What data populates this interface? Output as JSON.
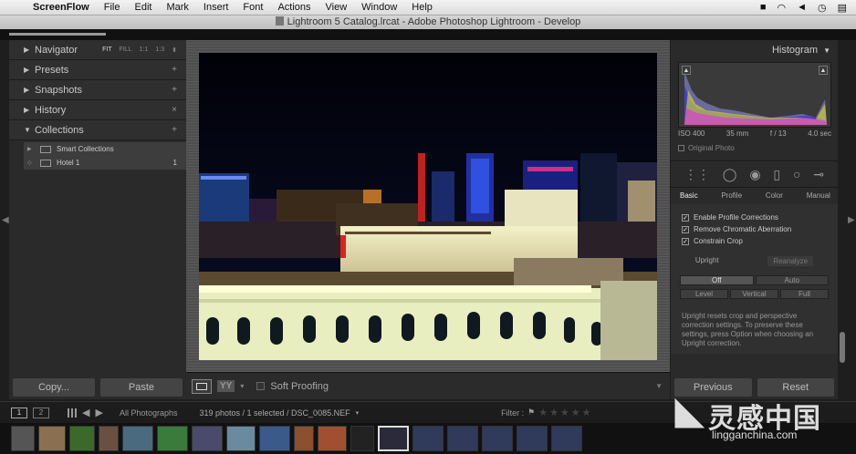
{
  "menubar": {
    "app": "ScreenFlow",
    "items": [
      "File",
      "Edit",
      "Mark",
      "Insert",
      "Font",
      "Actions",
      "View",
      "Window",
      "Help"
    ]
  },
  "window": {
    "title": "Lightroom 5 Catalog.lrcat - Adobe Photoshop Lightroom - Develop"
  },
  "left_panel": {
    "navigator": {
      "label": "Navigator",
      "opts": [
        "FIT",
        "FILL",
        "1:1",
        "1:3"
      ]
    },
    "presets": {
      "label": "Presets",
      "action": "+"
    },
    "snapshots": {
      "label": "Snapshots",
      "action": "+"
    },
    "history": {
      "label": "History",
      "action": "×"
    },
    "collections": {
      "label": "Collections",
      "action": "+",
      "items": [
        {
          "label": "Smart Collections",
          "count": ""
        },
        {
          "label": "Hotel 1",
          "count": "1"
        }
      ]
    },
    "copy_label": "Copy...",
    "paste_label": "Paste"
  },
  "toolbar": {
    "yy": "YY",
    "soft_proofing": "Soft Proofing"
  },
  "right_panel": {
    "histogram_label": "Histogram",
    "exif": {
      "iso": "ISO 400",
      "focal": "35 mm",
      "aperture": "f / 13",
      "shutter": "4.0 sec"
    },
    "original_photo": "Original Photo",
    "lens_tabs": [
      "Basic",
      "Profile",
      "Color",
      "Manual"
    ],
    "checks": [
      "Enable Profile Corrections",
      "Remove Chromatic Aberration",
      "Constrain Crop"
    ],
    "upright_label": "Upright",
    "reanalyze": "Reanalyze",
    "upright_row1": [
      "Off",
      "Auto"
    ],
    "upright_row2": [
      "Level",
      "Vertical",
      "Full"
    ],
    "upright_help": "Upright resets crop and perspective correction settings. To preserve these settings, press Option when choosing an Upright correction.",
    "previous_label": "Previous",
    "reset_label": "Reset"
  },
  "filmstrip_bar": {
    "monitor1": "1",
    "monitor2": "2",
    "source": "All Photographs",
    "info": "319 photos / 1 selected / DSC_0085.NEF",
    "filter_label": "Filter :"
  },
  "watermark": {
    "cn": "灵感中国",
    "url": "lingganchina.com"
  }
}
